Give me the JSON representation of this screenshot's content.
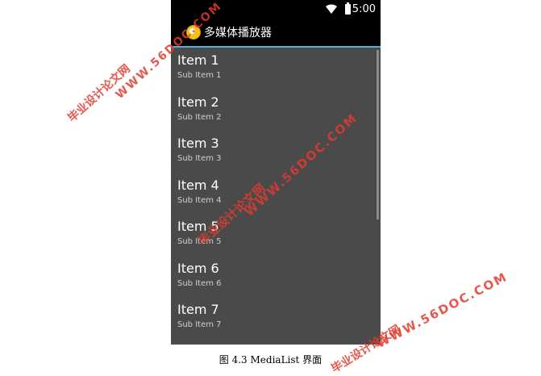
{
  "status_bar": {
    "time": "5:00",
    "icons": [
      "wifi-icon",
      "battery-icon"
    ]
  },
  "action_bar": {
    "title": "多媒体播放器",
    "icon": "app-icon",
    "accent_color": "#4db3d6"
  },
  "list": {
    "items": [
      {
        "title": "Item 1",
        "subtitle": "Sub Item 1"
      },
      {
        "title": "Item 2",
        "subtitle": "Sub Item 2"
      },
      {
        "title": "Item 3",
        "subtitle": "Sub Item 3"
      },
      {
        "title": "Item 4",
        "subtitle": "Sub Item 4"
      },
      {
        "title": "Item 5",
        "subtitle": "Sub Item 5"
      },
      {
        "title": "Item 6",
        "subtitle": "Sub Item 6"
      },
      {
        "title": "Item 7",
        "subtitle": "Sub Item 7"
      }
    ]
  },
  "caption": "图 4.3 MediaList 界面",
  "watermarks": {
    "site_cn": "毕业设计论文网",
    "site_url": "WWW.56DOC.COM",
    "color": "#e23a2f"
  }
}
